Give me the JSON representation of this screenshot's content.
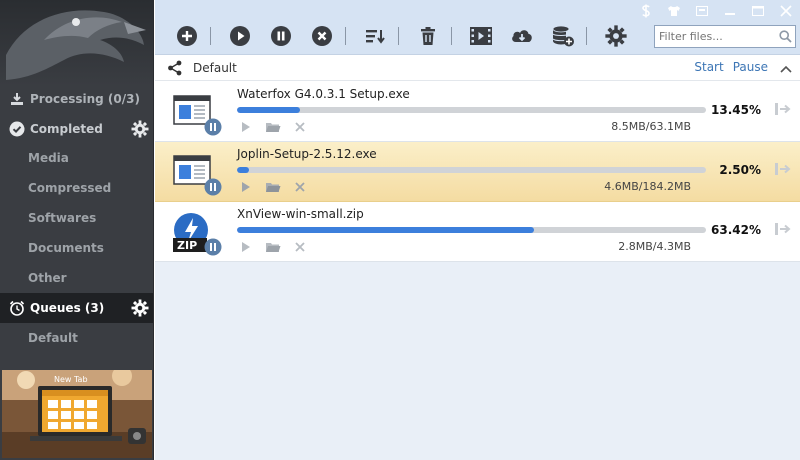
{
  "sidebar": {
    "processing": "Processing (0/3)",
    "completed": "Completed",
    "categories": [
      "Media",
      "Compressed",
      "Softwares",
      "Documents",
      "Other"
    ],
    "queues": "Queues (3)",
    "queue_items": [
      "Default"
    ],
    "promo_text": "New Tab"
  },
  "toolbar": {
    "buttons": [
      "add-icon",
      "play-icon",
      "pause-icon",
      "cancel-icon",
      "sort-icon",
      "trash-icon",
      "video-icon",
      "cloud-download-icon",
      "database-add-icon",
      "gear-icon"
    ],
    "filter_placeholder": "Filter files..."
  },
  "queue": {
    "name": "Default",
    "start_label": "Start",
    "pause_label": "Pause"
  },
  "downloads": [
    {
      "name": "Waterfox G4.0.3.1 Setup.exe",
      "percent": "13.45%",
      "progress": 13.45,
      "size": "8.5MB/63.1MB",
      "type": "exe",
      "selected": false
    },
    {
      "name": "Joplin-Setup-2.5.12.exe",
      "percent": "2.50%",
      "progress": 2.5,
      "size": "4.6MB/184.2MB",
      "type": "exe",
      "selected": true
    },
    {
      "name": "XnView-win-small.zip",
      "percent": "63.42%",
      "progress": 63.42,
      "size": "2.8MB/4.3MB",
      "type": "zip",
      "selected": false
    }
  ],
  "colors": {
    "accent": "#3c7fdc",
    "sidebar_bg": "#3a3d42",
    "titlebar_bg": "#d6e3f3",
    "selected_row": "#f6e2ad"
  }
}
